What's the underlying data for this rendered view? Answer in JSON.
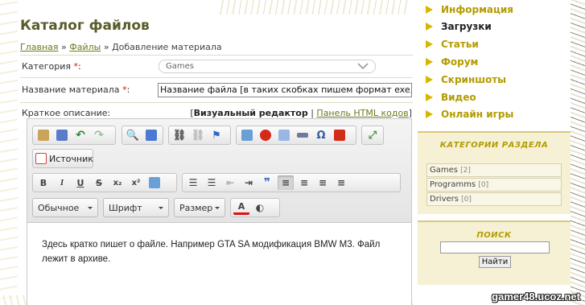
{
  "page": {
    "title": "Каталог файлов",
    "breadcrumb": {
      "home": "Главная",
      "sep1": " » ",
      "files": "Файлы",
      "sep2": " » ",
      "current": "Добавление материала"
    }
  },
  "form": {
    "category_label": "Категория",
    "category_value": "Games",
    "name_label": "Название материала",
    "name_value": "Название файла [в таких скобках пишем формат exe, torrent,",
    "required_mark": "*",
    "colon": ":",
    "short_desc_label": "Краткое описание:",
    "editor_switch": {
      "open": "[",
      "visual": "Визуальный редактор",
      "sep": " | ",
      "html": "Панель HTML кодов",
      "close": "]"
    }
  },
  "editor": {
    "source_label": "Источник",
    "bold": "B",
    "italic": "I",
    "underline": "U",
    "strike": "S",
    "sub": "x₂",
    "sup": "x²",
    "quote": "❞",
    "format_dd": "Обычное",
    "font_dd": "Шрифт",
    "size_dd": "Размер",
    "font_color": "A",
    "content": "Здесь кратко пишет о файле. Например GTA SA модификация BMW M3. Файл лежит в архиве."
  },
  "sidebar": {
    "nav": [
      {
        "label": "Информация"
      },
      {
        "label": "Загрузки"
      },
      {
        "label": "Статьи"
      },
      {
        "label": "Форум"
      },
      {
        "label": "Скриншоты"
      },
      {
        "label": "Видео"
      },
      {
        "label": "Онлайн игры"
      }
    ],
    "categories_title": "КАТЕГОРИИ РАЗДЕЛА",
    "categories": [
      {
        "name": "Games",
        "count": "[2]"
      },
      {
        "name": "Programms",
        "count": "[0]"
      },
      {
        "name": "Drivers",
        "count": "[0]"
      }
    ],
    "search_title": "ПОИСК",
    "search_button": "Найти"
  },
  "watermark": "gamer48.ucoz.net",
  "colors": {
    "accent": "#b39b00",
    "title": "#5b5b2a",
    "link": "#6b7a1e",
    "panel": "#f6f1d5"
  }
}
